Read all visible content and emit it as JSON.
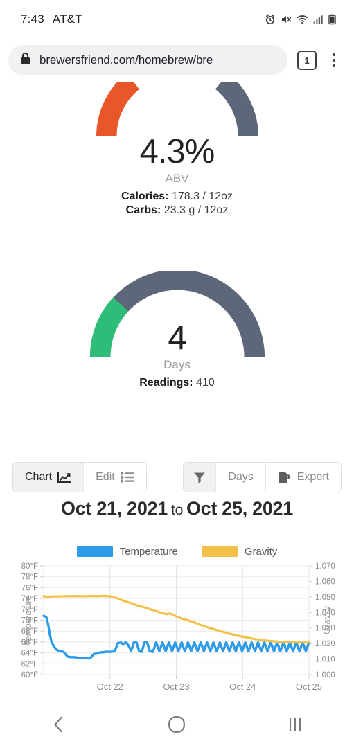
{
  "status_bar": {
    "time": "7:43",
    "carrier": "AT&T",
    "icons": [
      "alarm-icon",
      "mute-icon",
      "wifi-icon",
      "cell-signal-icon",
      "battery-icon"
    ]
  },
  "browser": {
    "url": "brewersfriend.com/homebrew/bre",
    "lock_icon": "lock-icon",
    "tab_count": "1",
    "menu_icon": "kebab-menu-icon"
  },
  "abv_gauge": {
    "value": "4.3%",
    "unit": "ABV",
    "calories_label": "Calories:",
    "calories_value": "178.3 / 12oz",
    "carbs_label": "Carbs:",
    "carbs_value": "23.3 g / 12oz",
    "arc_left_color": "#E8562A",
    "arc_right_color": "#5D6779"
  },
  "days_gauge": {
    "value": "4",
    "unit": "Days",
    "readings_label": "Readings:",
    "readings_value": "410",
    "arc_fill_color": "#2EBD78",
    "arc_track_color": "#5D6779"
  },
  "toolbar": {
    "left": [
      {
        "label": "Chart",
        "icon": "line-chart-icon",
        "active": true
      },
      {
        "label": "Edit",
        "icon": "list-icon",
        "active": false
      }
    ],
    "right": [
      {
        "label": "",
        "icon": "filter-icon",
        "active": true
      },
      {
        "label": "Days",
        "icon": "",
        "active": false
      },
      {
        "label": "Export",
        "icon": "file-export-icon",
        "active": false
      }
    ]
  },
  "date_range": {
    "start": "Oct 21, 2021",
    "separator": "to",
    "end": "Oct 25, 2021"
  },
  "chart_data": {
    "type": "line",
    "title": "",
    "xlabel": "",
    "ylabel": "Temperature",
    "y2label": "Gravity",
    "grid": true,
    "legend_position": "top",
    "x_tick_labels": [
      "Oct 22",
      "Oct 23",
      "Oct 24",
      "Oct 25"
    ],
    "x_tick_positions": [
      0.25,
      0.5,
      0.75,
      1.0
    ],
    "xlim": [
      0,
      1
    ],
    "ylim": [
      60,
      80
    ],
    "y_tick_labels": [
      "80°F",
      "78°F",
      "76°F",
      "74°F",
      "72°F",
      "70°F",
      "68°F",
      "66°F",
      "64°F",
      "62°F",
      "60°F"
    ],
    "y_tick_values": [
      80,
      78,
      76,
      74,
      72,
      70,
      68,
      66,
      64,
      62,
      60
    ],
    "y2lim": [
      1.0,
      1.07
    ],
    "y2_tick_labels": [
      "1.070",
      "1.060",
      "1.050",
      "1.040",
      "1.030",
      "1.020",
      "1.010",
      "1.000"
    ],
    "y2_tick_values": [
      1.07,
      1.06,
      1.05,
      1.04,
      1.03,
      1.02,
      1.01,
      1.0
    ],
    "series": [
      {
        "name": "Temperature",
        "axis": "left",
        "color": "#2E9BE8",
        "unit": "°F",
        "x": [
          0.0,
          0.01,
          0.018,
          0.024,
          0.03,
          0.038,
          0.048,
          0.06,
          0.075,
          0.09,
          0.105,
          0.118,
          0.13,
          0.145,
          0.16,
          0.175,
          0.19,
          0.205,
          0.215,
          0.225,
          0.235,
          0.245,
          0.255,
          0.268,
          0.28,
          0.292,
          0.3,
          0.31,
          0.32,
          0.33,
          0.34,
          0.35,
          0.36,
          0.37,
          0.38,
          0.39,
          0.4,
          0.412,
          0.424,
          0.436,
          0.448,
          0.46,
          0.472,
          0.484,
          0.496,
          0.508,
          0.52,
          0.532,
          0.544,
          0.556,
          0.568,
          0.58,
          0.592,
          0.604,
          0.616,
          0.628,
          0.64,
          0.652,
          0.664,
          0.676,
          0.688,
          0.7,
          0.712,
          0.724,
          0.736,
          0.748,
          0.76,
          0.772,
          0.784,
          0.796,
          0.808,
          0.82,
          0.832,
          0.844,
          0.856,
          0.868,
          0.88,
          0.892,
          0.904,
          0.916,
          0.928,
          0.94,
          0.952,
          0.964,
          0.976,
          0.988,
          1.0
        ],
        "y": [
          70.8,
          70.6,
          69.0,
          67.2,
          66.0,
          65.2,
          64.6,
          64.3,
          64.2,
          63.3,
          63.2,
          63.2,
          63.1,
          63.0,
          63.0,
          63.0,
          63.8,
          63.9,
          64.1,
          64.1,
          64.2,
          64.2,
          64.2,
          64.3,
          65.8,
          65.9,
          65.5,
          66.0,
          65.3,
          64.4,
          65.9,
          65.9,
          64.3,
          64.2,
          65.9,
          65.9,
          64.3,
          64.2,
          65.9,
          64.3,
          65.9,
          64.3,
          65.9,
          64.3,
          65.9,
          64.3,
          65.9,
          64.3,
          65.9,
          64.3,
          65.9,
          64.3,
          65.9,
          64.3,
          65.9,
          64.3,
          65.9,
          64.3,
          65.9,
          64.3,
          65.9,
          64.3,
          65.9,
          64.3,
          65.9,
          64.3,
          65.9,
          64.3,
          65.9,
          64.3,
          65.9,
          64.3,
          65.9,
          64.3,
          65.9,
          64.3,
          65.9,
          64.3,
          65.9,
          64.3,
          65.9,
          64.3,
          65.9,
          64.3,
          65.9,
          64.3,
          65.9
        ]
      },
      {
        "name": "Gravity",
        "axis": "right",
        "color": "#F5C04A",
        "unit": "SG",
        "x": [
          0.0,
          0.012,
          0.024,
          0.036,
          0.05,
          0.065,
          0.08,
          0.095,
          0.11,
          0.125,
          0.14,
          0.155,
          0.17,
          0.185,
          0.2,
          0.215,
          0.23,
          0.245,
          0.258,
          0.27,
          0.282,
          0.294,
          0.306,
          0.318,
          0.33,
          0.342,
          0.354,
          0.366,
          0.378,
          0.39,
          0.402,
          0.414,
          0.426,
          0.438,
          0.45,
          0.462,
          0.474,
          0.486,
          0.498,
          0.51,
          0.522,
          0.534,
          0.546,
          0.558,
          0.57,
          0.582,
          0.594,
          0.606,
          0.618,
          0.63,
          0.642,
          0.654,
          0.666,
          0.678,
          0.69,
          0.702,
          0.714,
          0.726,
          0.738,
          0.75,
          0.762,
          0.774,
          0.786,
          0.798,
          0.81,
          0.822,
          0.834,
          0.846,
          0.858,
          0.87,
          0.882,
          0.894,
          0.906,
          0.918,
          0.93,
          0.942,
          0.954,
          0.966,
          0.978,
          0.99,
          1.0
        ],
        "y": [
          1.0505,
          1.05,
          1.0502,
          1.0503,
          1.0503,
          1.0504,
          1.0504,
          1.0505,
          1.0505,
          1.0505,
          1.0505,
          1.0504,
          1.0505,
          1.0506,
          1.0504,
          1.0506,
          1.0506,
          1.0505,
          1.0502,
          1.0496,
          1.0488,
          1.048,
          1.0472,
          1.0466,
          1.046,
          1.0452,
          1.0444,
          1.0438,
          1.0434,
          1.0428,
          1.042,
          1.0414,
          1.0408,
          1.04,
          1.0396,
          1.0388,
          1.0394,
          1.0386,
          1.0376,
          1.0368,
          1.036,
          1.0356,
          1.0348,
          1.034,
          1.0334,
          1.0326,
          1.0318,
          1.0312,
          1.0304,
          1.0298,
          1.0292,
          1.0286,
          1.028,
          1.0274,
          1.0268,
          1.0262,
          1.0258,
          1.0252,
          1.0248,
          1.0244,
          1.024,
          1.0236,
          1.0232,
          1.0228,
          1.0226,
          1.0223,
          1.022,
          1.0218,
          1.0216,
          1.0214,
          1.0212,
          1.021,
          1.021,
          1.0209,
          1.0208,
          1.0208,
          1.0207,
          1.0206,
          1.0207,
          1.0206,
          1.0207
        ]
      }
    ]
  },
  "nav_bar": {
    "back_icon": "back-chevron-icon",
    "home_icon": "home-circle-icon",
    "recents_icon": "recents-bars-icon"
  }
}
